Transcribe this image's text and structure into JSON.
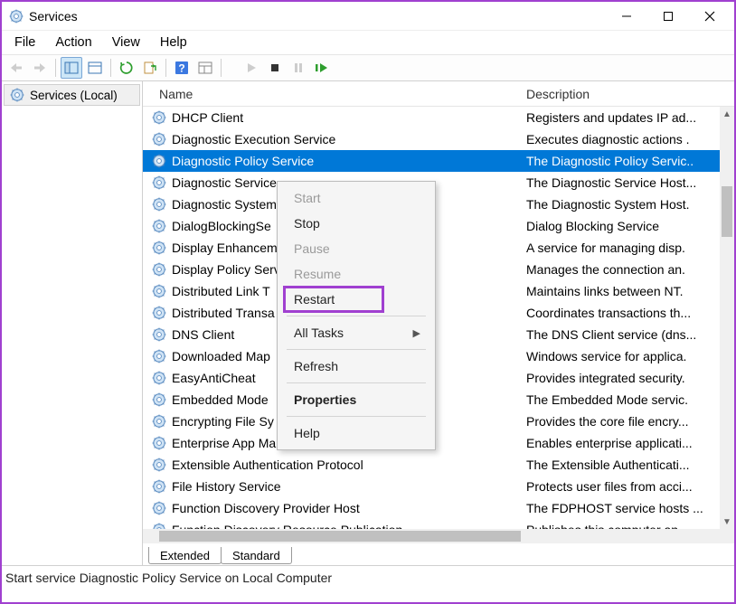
{
  "window": {
    "title": "Services"
  },
  "menu": {
    "file": "File",
    "action": "Action",
    "view": "View",
    "help": "Help"
  },
  "tree": {
    "root": "Services (Local)"
  },
  "columns": {
    "name": "Name",
    "description": "Description"
  },
  "services": [
    {
      "name": "DHCP Client",
      "desc": "Registers and updates IP ad..."
    },
    {
      "name": "Diagnostic Execution Service",
      "desc": "Executes diagnostic actions ."
    },
    {
      "name": "Diagnostic Policy Service",
      "desc": "The Diagnostic Policy Servic..",
      "selected": true
    },
    {
      "name": "Diagnostic Service",
      "desc": "The Diagnostic Service Host..."
    },
    {
      "name": "Diagnostic System",
      "desc": "The Diagnostic System Host."
    },
    {
      "name": "DialogBlockingSe",
      "desc": "Dialog Blocking Service"
    },
    {
      "name": "Display Enhancem",
      "desc": "A service for managing disp."
    },
    {
      "name": "Display Policy Serv",
      "desc": "Manages the connection an."
    },
    {
      "name": "Distributed Link T",
      "desc": "Maintains links between NT."
    },
    {
      "name": "Distributed Transa",
      "desc": "Coordinates transactions th..."
    },
    {
      "name": "DNS Client",
      "desc": "The DNS Client service (dns..."
    },
    {
      "name": "Downloaded Map",
      "desc": "Windows service for applica."
    },
    {
      "name": "EasyAntiCheat",
      "desc": "Provides integrated security."
    },
    {
      "name": "Embedded Mode",
      "desc": "The Embedded Mode servic."
    },
    {
      "name": "Encrypting File Sy",
      "desc": "Provides the core file encry..."
    },
    {
      "name": "Enterprise App Management Service",
      "desc": "Enables enterprise applicati..."
    },
    {
      "name": "Extensible Authentication Protocol",
      "desc": "The Extensible Authenticati..."
    },
    {
      "name": "File History Service",
      "desc": "Protects user files from acci..."
    },
    {
      "name": "Function Discovery Provider Host",
      "desc": "The FDPHOST service hosts ..."
    },
    {
      "name": "Function Discovery Resource Publication",
      "desc": "Publishes this computer an"
    }
  ],
  "context_menu": {
    "start": "Start",
    "stop": "Stop",
    "pause": "Pause",
    "resume": "Resume",
    "restart": "Restart",
    "all_tasks": "All Tasks",
    "refresh": "Refresh",
    "properties": "Properties",
    "help": "Help"
  },
  "tabs": {
    "extended": "Extended",
    "standard": "Standard"
  },
  "status": "Start service Diagnostic Policy Service on Local Computer"
}
